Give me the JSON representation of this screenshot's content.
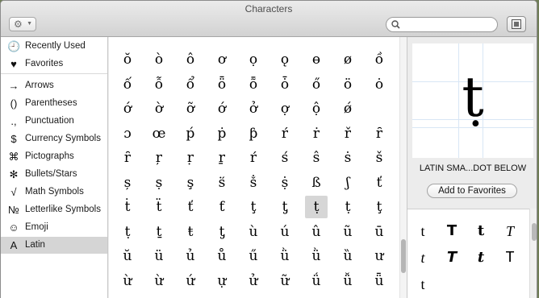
{
  "window": {
    "title": "Characters"
  },
  "toolbar": {
    "gear_icon": "gear-icon",
    "search_placeholder": "",
    "search_value": ""
  },
  "sidebar": {
    "items": [
      {
        "icon": "🕘",
        "label": "Recently Used"
      },
      {
        "icon": "♥",
        "label": "Favorites"
      },
      {
        "icon": "→",
        "label": "Arrows"
      },
      {
        "icon": "()",
        "label": "Parentheses"
      },
      {
        "icon": ".,",
        "label": "Punctuation"
      },
      {
        "icon": "$",
        "label": "Currency Symbols"
      },
      {
        "icon": "⌘",
        "label": "Pictographs"
      },
      {
        "icon": "✻",
        "label": "Bullets/Stars"
      },
      {
        "icon": "√",
        "label": "Math Symbols"
      },
      {
        "icon": "№",
        "label": "Letterlike Symbols"
      },
      {
        "icon": "☺",
        "label": "Emoji"
      },
      {
        "icon": "A",
        "label": "Latin"
      }
    ],
    "selected_index": 11
  },
  "grid": {
    "rows": [
      [
        "ŏ",
        "ò",
        "ô",
        "ơ",
        "ọ",
        "ǫ",
        "ɵ",
        "ø",
        "ồ"
      ],
      [
        "ố",
        "ỗ",
        "ổ",
        "ȫ",
        "ȭ",
        "ȱ",
        "ő",
        "ö",
        "ȯ"
      ],
      [
        "ớ",
        "ờ",
        "ỡ",
        "ớ",
        "ở",
        "ợ",
        "ộ",
        "ǿ",
        ""
      ],
      [
        "ɔ",
        "œ",
        "ṕ",
        "ṗ",
        "ƥ",
        "ŕ",
        "ṙ",
        "ř",
        "ȓ"
      ],
      [
        "ȓ",
        "ŗ",
        "ṛ",
        "ṟ",
        "ŕ",
        "ś",
        "ŝ",
        "ṡ",
        "š"
      ],
      [
        "ș",
        "ṣ",
        "ş",
        "ṥ",
        "ṧ",
        "ṩ",
        "ß",
        "ʃ",
        "ť"
      ],
      [
        "ṫ",
        "ẗ",
        "ť",
        "ƭ",
        "ţ",
        "ƫ",
        "ṭ",
        "ṭ",
        "ţ"
      ],
      [
        "ṭ",
        "ṯ",
        "ŧ",
        "ƫ",
        "ù",
        "ú",
        "û",
        "ũ",
        "ū"
      ],
      [
        "ŭ",
        "ü",
        "ủ",
        "ů",
        "ű",
        "ǜ",
        "ǜ",
        "ȕ",
        "ư"
      ],
      [
        "ừ",
        "ừ",
        "ứ",
        "ự",
        "ử",
        "ữ",
        "ǘ",
        "ǚ",
        "ǖ"
      ]
    ],
    "selected": {
      "row": 6,
      "col": 6
    }
  },
  "inspector": {
    "glyph": "ṭ",
    "name": "LATIN SMA...DOT BELOW",
    "add_favorites_label": "Add to Favorites",
    "variants_header": "",
    "variants": [
      "t",
      "T",
      "t",
      "T",
      "t",
      "T",
      "t",
      "T",
      "t"
    ]
  }
}
